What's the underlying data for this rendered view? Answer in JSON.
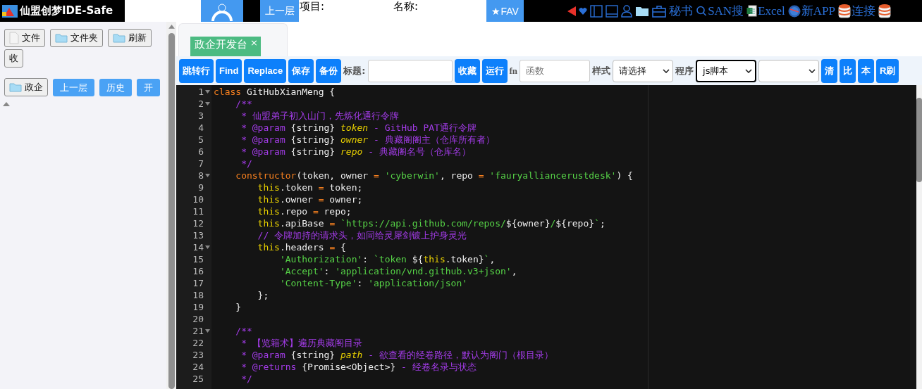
{
  "header": {
    "title": "仙盟创梦IDE-Safe",
    "up_button": "上一层",
    "project_label": "项目:",
    "name_label": "名称:",
    "fav_button": "★FAV",
    "links": [
      {
        "kind": "secretary",
        "label": "秘书"
      },
      {
        "kind": "search",
        "label": "SAN搜"
      },
      {
        "kind": "excel",
        "label": "Excel"
      },
      {
        "kind": "app",
        "label": "新APP"
      },
      {
        "kind": "database",
        "label": "连接"
      },
      {
        "kind": "database"
      }
    ]
  },
  "sidebar": {
    "buttons": [
      {
        "label": "文件"
      },
      {
        "label": "文件夹"
      },
      {
        "label": "刷新"
      },
      {
        "label": "收"
      }
    ],
    "nav": [
      {
        "label": "政企",
        "kind": "plain"
      },
      {
        "label": "上一层",
        "kind": "primary"
      },
      {
        "label": "历史",
        "kind": "primary"
      },
      {
        "label": "开",
        "kind": "primary"
      }
    ]
  },
  "tabs": [
    {
      "label": "政企开发台",
      "close": "×",
      "selected": true
    }
  ],
  "toolbar": [
    {
      "kind": "button",
      "label": "跳转行"
    },
    {
      "kind": "button",
      "label": "Find"
    },
    {
      "kind": "button",
      "label": "Replace"
    },
    {
      "kind": "button",
      "label": "保存"
    },
    {
      "kind": "button",
      "label": "备份"
    },
    {
      "kind": "label",
      "text": "标题:"
    },
    {
      "kind": "input"
    },
    {
      "kind": "button",
      "label": "收藏"
    },
    {
      "kind": "button",
      "label": "运行"
    },
    {
      "kind": "label",
      "text": "fn"
    },
    {
      "kind": "input",
      "placeholder": "函数"
    },
    {
      "kind": "label",
      "text": "样式"
    },
    {
      "kind": "select",
      "value": "请选择",
      "focused": false
    },
    {
      "kind": "label",
      "text": "程序"
    },
    {
      "kind": "select",
      "value": "js脚本",
      "focused": true
    },
    {
      "kind": "select",
      "focused": false
    },
    {
      "kind": "button",
      "label": "清"
    },
    {
      "kind": "button",
      "label": "比"
    },
    {
      "kind": "button",
      "label": "本"
    },
    {
      "kind": "button",
      "label": "R刷"
    }
  ],
  "editor": {
    "lines": [
      {
        "number": "1",
        "fold": true,
        "tokens": [
          {
            "kind": "keyword",
            "text": "class"
          },
          {
            "kind": "plain",
            "text": " GitHubXianMeng {"
          }
        ]
      },
      {
        "number": "2",
        "fold": true,
        "tokens": [
          {
            "kind": "comment",
            "text": "    /**"
          }
        ]
      },
      {
        "number": "3",
        "fold": false,
        "tokens": [
          {
            "kind": "comment",
            "text": "     * 仙盟弟子初入山门，先炼化通行令牌"
          }
        ]
      },
      {
        "number": "4",
        "fold": false,
        "tokens": [
          {
            "kind": "comment",
            "text": "     * @param "
          },
          {
            "kind": "doctype",
            "text": "{string} "
          },
          {
            "kind": "docparam",
            "text": "token"
          },
          {
            "kind": "comment",
            "text": " - GitHub PAT通行令牌"
          }
        ]
      },
      {
        "number": "5",
        "fold": false,
        "tokens": [
          {
            "kind": "comment",
            "text": "     * @param "
          },
          {
            "kind": "doctype",
            "text": "{string} "
          },
          {
            "kind": "docparam",
            "text": "owner"
          },
          {
            "kind": "comment",
            "text": " - 典藏阁阁主（仓库所有者）"
          }
        ]
      },
      {
        "number": "6",
        "fold": false,
        "tokens": [
          {
            "kind": "comment",
            "text": "     * @param "
          },
          {
            "kind": "doctype",
            "text": "{string} "
          },
          {
            "kind": "docparam",
            "text": "repo"
          },
          {
            "kind": "comment",
            "text": " - 典藏阁名号（仓库名）"
          }
        ]
      },
      {
        "number": "7",
        "fold": false,
        "tokens": [
          {
            "kind": "comment",
            "text": "     */"
          }
        ]
      },
      {
        "number": "8",
        "fold": true,
        "tokens": [
          {
            "kind": "keyword",
            "text": "    constructor"
          },
          {
            "kind": "plain",
            "text": "(token, owner "
          },
          {
            "kind": "operator",
            "text": "="
          },
          {
            "kind": "string",
            "text": " 'cyberwin'"
          },
          {
            "kind": "plain",
            "text": ", repo "
          },
          {
            "kind": "operator",
            "text": "="
          },
          {
            "kind": "string",
            "text": " 'fauryalliancerustdesk'"
          },
          {
            "kind": "plain",
            "text": ") {"
          }
        ]
      },
      {
        "number": "9",
        "fold": false,
        "tokens": [
          {
            "kind": "this",
            "text": "        this"
          },
          {
            "kind": "plain",
            "text": ".token "
          },
          {
            "kind": "operator",
            "text": "="
          },
          {
            "kind": "plain",
            "text": " token;"
          }
        ]
      },
      {
        "number": "10",
        "fold": false,
        "tokens": [
          {
            "kind": "this",
            "text": "        this"
          },
          {
            "kind": "plain",
            "text": ".owner "
          },
          {
            "kind": "operator",
            "text": "="
          },
          {
            "kind": "plain",
            "text": " owner;"
          }
        ]
      },
      {
        "number": "11",
        "fold": false,
        "tokens": [
          {
            "kind": "this",
            "text": "        this"
          },
          {
            "kind": "plain",
            "text": ".repo "
          },
          {
            "kind": "operator",
            "text": "="
          },
          {
            "kind": "plain",
            "text": " repo;"
          }
        ]
      },
      {
        "number": "12",
        "fold": false,
        "tokens": [
          {
            "kind": "this",
            "text": "        this"
          },
          {
            "kind": "plain",
            "text": ".apiBase "
          },
          {
            "kind": "operator",
            "text": "="
          },
          {
            "kind": "string",
            "text": " `https://api.github.com/repos/"
          },
          {
            "kind": "plain",
            "text": "${owner}"
          },
          {
            "kind": "string",
            "text": "/"
          },
          {
            "kind": "plain",
            "text": "${repo}"
          },
          {
            "kind": "string",
            "text": "`"
          },
          {
            "kind": "plain",
            "text": ";"
          }
        ]
      },
      {
        "number": "13",
        "fold": false,
        "tokens": [
          {
            "kind": "comment",
            "text": "        // 令牌加持的请求头，如同给灵犀剑镀上护身灵光"
          }
        ]
      },
      {
        "number": "14",
        "fold": true,
        "tokens": [
          {
            "kind": "this",
            "text": "        this"
          },
          {
            "kind": "plain",
            "text": ".headers "
          },
          {
            "kind": "operator",
            "text": "="
          },
          {
            "kind": "plain",
            "text": " {"
          }
        ]
      },
      {
        "number": "15",
        "fold": false,
        "tokens": [
          {
            "kind": "string",
            "text": "            'Authorization'"
          },
          {
            "kind": "plain",
            "text": ": "
          },
          {
            "kind": "string",
            "text": "`token "
          },
          {
            "kind": "plain",
            "text": "${"
          },
          {
            "kind": "this",
            "text": "this"
          },
          {
            "kind": "plain",
            "text": ".token}"
          },
          {
            "kind": "string",
            "text": "`"
          },
          {
            "kind": "plain",
            "text": ","
          }
        ]
      },
      {
        "number": "16",
        "fold": false,
        "tokens": [
          {
            "kind": "string",
            "text": "            'Accept'"
          },
          {
            "kind": "plain",
            "text": ": "
          },
          {
            "kind": "string",
            "text": "'application/vnd.github.v3+json'"
          },
          {
            "kind": "plain",
            "text": ","
          }
        ]
      },
      {
        "number": "17",
        "fold": false,
        "tokens": [
          {
            "kind": "string",
            "text": "            'Content-Type'"
          },
          {
            "kind": "plain",
            "text": ": "
          },
          {
            "kind": "string",
            "text": "'application/json'"
          }
        ]
      },
      {
        "number": "18",
        "fold": false,
        "tokens": [
          {
            "kind": "plain",
            "text": "        };"
          }
        ]
      },
      {
        "number": "19",
        "fold": false,
        "tokens": [
          {
            "kind": "plain",
            "text": "    }"
          }
        ]
      },
      {
        "number": "20",
        "fold": false
      },
      {
        "number": "21",
        "fold": true,
        "tokens": [
          {
            "kind": "comment",
            "text": "    /**"
          }
        ]
      },
      {
        "number": "22",
        "fold": false,
        "tokens": [
          {
            "kind": "comment",
            "text": "     * 【览籍术】遍历典藏阁目录"
          }
        ]
      },
      {
        "number": "23",
        "fold": false,
        "tokens": [
          {
            "kind": "comment",
            "text": "     * @param "
          },
          {
            "kind": "doctype",
            "text": "{string} "
          },
          {
            "kind": "docparam",
            "text": "path"
          },
          {
            "kind": "comment",
            "text": " - 欲查看的经卷路径，默认为阁门（根目录）"
          }
        ]
      },
      {
        "number": "24",
        "fold": false,
        "tokens": [
          {
            "kind": "comment",
            "text": "     * @returns "
          },
          {
            "kind": "doctype",
            "text": "{Promise<Object>}"
          },
          {
            "kind": "comment",
            "text": " - 经卷名录与状态"
          }
        ]
      },
      {
        "number": "25",
        "fold": false,
        "tokens": [
          {
            "kind": "comment",
            "text": "     */"
          }
        ]
      }
    ]
  }
}
